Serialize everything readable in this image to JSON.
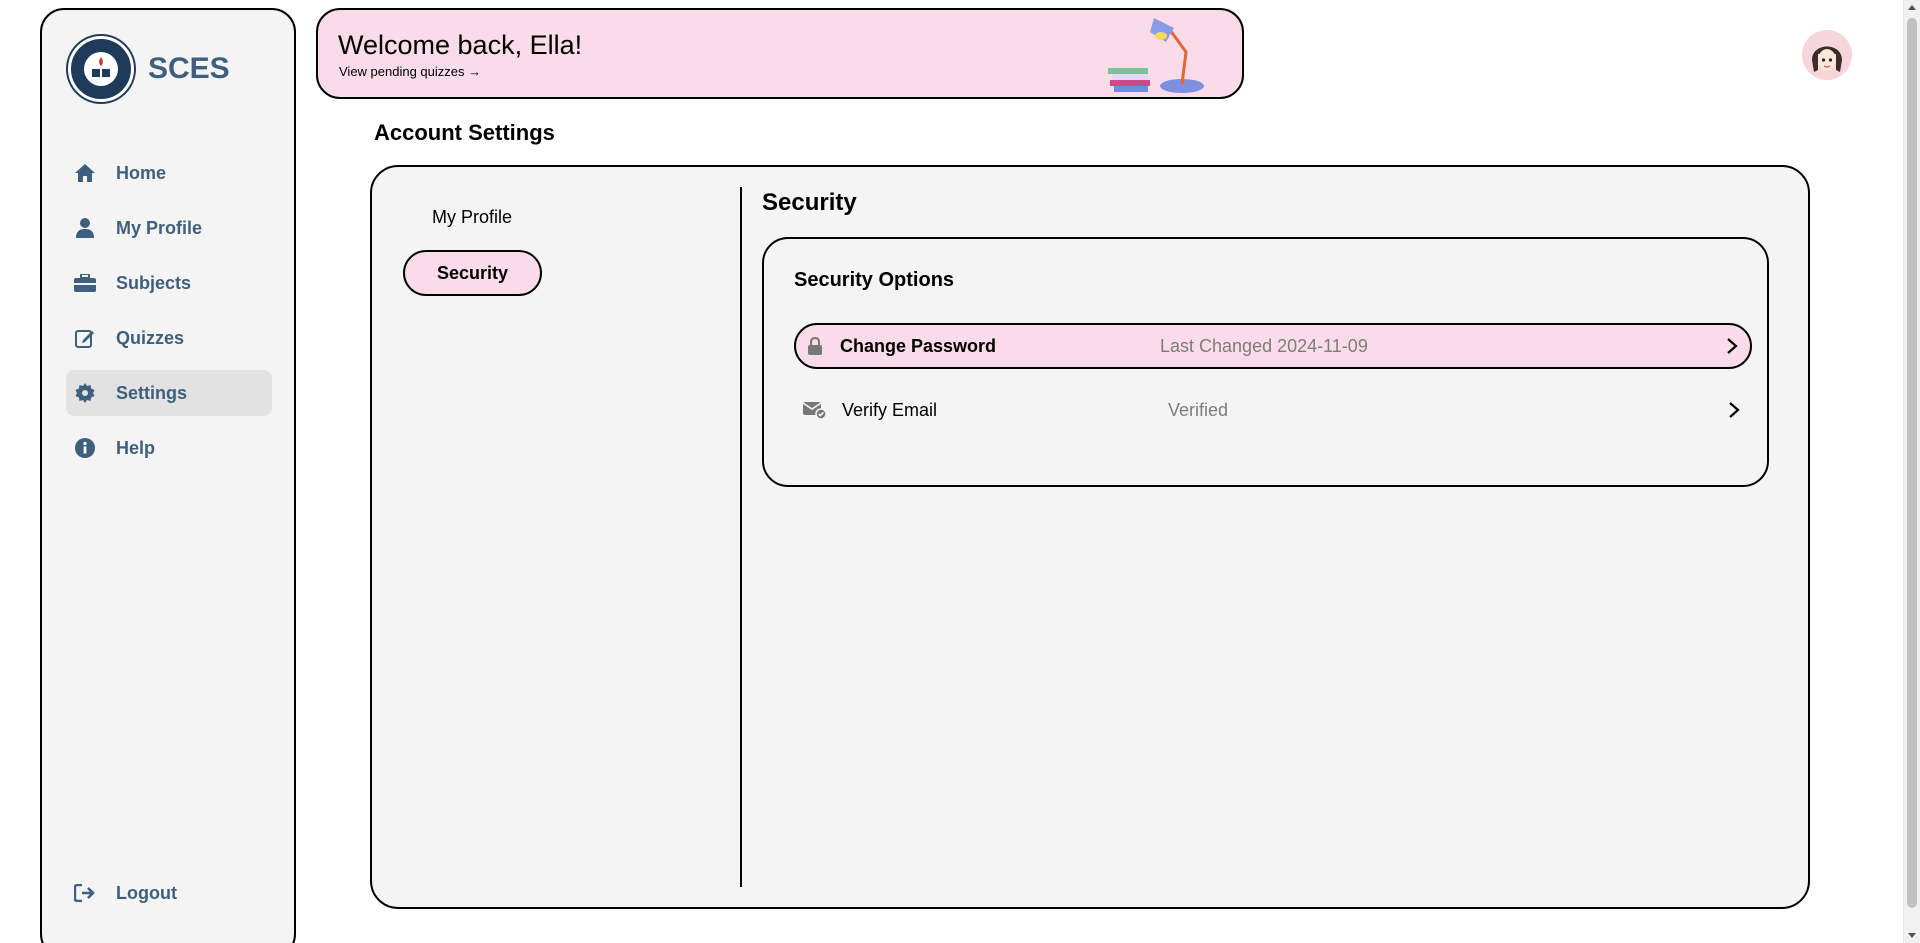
{
  "sidebar": {
    "brand": "SCES",
    "items": [
      {
        "label": "Home",
        "icon": "home-icon"
      },
      {
        "label": "My Profile",
        "icon": "user-icon"
      },
      {
        "label": "Subjects",
        "icon": "briefcase-icon"
      },
      {
        "label": "Quizzes",
        "icon": "edit-icon"
      },
      {
        "label": "Settings",
        "icon": "gear-icon",
        "active": true
      },
      {
        "label": "Help",
        "icon": "info-icon"
      }
    ],
    "logout": "Logout"
  },
  "banner": {
    "title": "Welcome back, Ella!",
    "link": "View pending quizzes →"
  },
  "page": {
    "title": "Account Settings"
  },
  "settings": {
    "tabs": [
      "My Profile",
      "Security"
    ],
    "active_tab": "Security",
    "section_title": "Security",
    "options_title": "Security Options",
    "options": [
      {
        "label": "Change Password",
        "status": "Last Changed 2024-11-09",
        "icon": "lock-icon"
      },
      {
        "label": "Verify Email",
        "status": "Verified",
        "icon": "envelope-check-icon"
      }
    ]
  },
  "colors": {
    "accent_pink": "#fadbe8",
    "nav_text": "#3e5f7d",
    "panel_bg": "#f4f4f4"
  }
}
